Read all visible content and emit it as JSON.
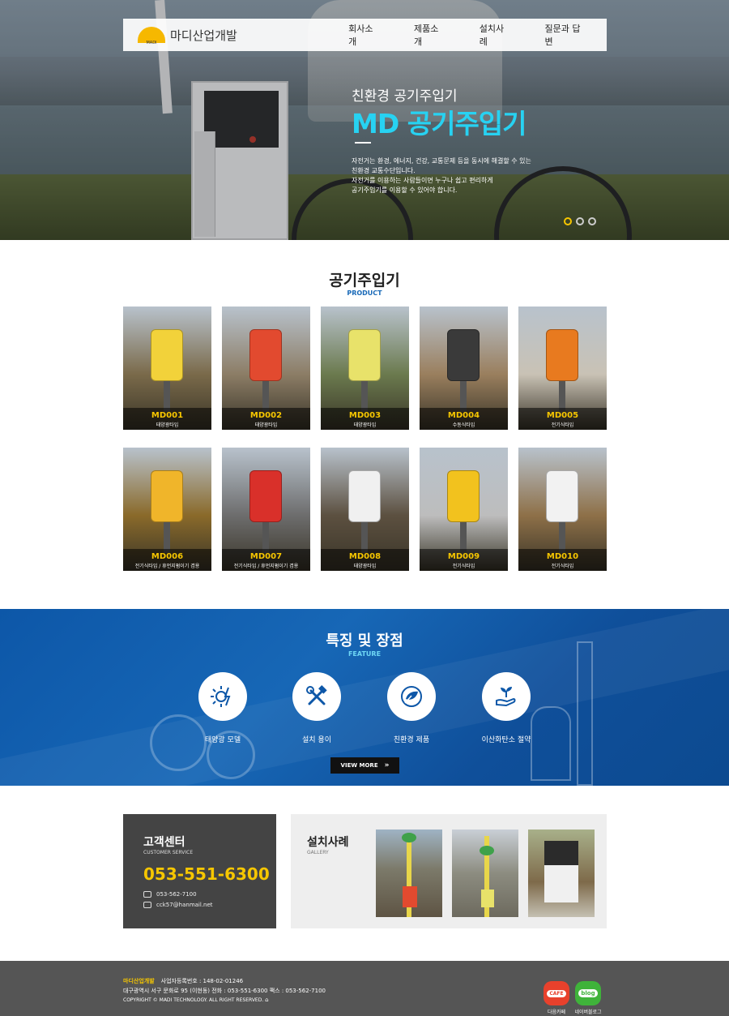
{
  "header": {
    "logo_text": "마디산업개발",
    "logo_badge": "MADI",
    "nav": [
      "회사소개",
      "제품소개",
      "설치사례",
      "질문과 답변"
    ]
  },
  "hero": {
    "subtitle": "친환경 공기주입기",
    "title": "MD 공기주입기",
    "desc": [
      "자전거는 환경, 에너지, 건강, 교통문제 등을 동시에 해결할 수 있는",
      "친환경 교통수단입니다.",
      "자전거를 이용하는 사람들이면 누구나 쉽고 편리하게",
      "공기주입기를 이용할 수 있어야 합니다."
    ],
    "slides": 3,
    "active_slide": 1
  },
  "products_section": {
    "title": "공기주입기",
    "subtitle": "PRODUCT",
    "items": [
      {
        "code": "MD001",
        "desc": "태양광타입",
        "bg": "#7a6a4a",
        "device": "#f2d23a"
      },
      {
        "code": "MD002",
        "desc": "태양광타입",
        "bg": "#8c7d66",
        "device": "#e24a2f"
      },
      {
        "code": "MD003",
        "desc": "태양광타입",
        "bg": "#6b7a4e",
        "device": "#e8e26a"
      },
      {
        "code": "MD004",
        "desc": "수동식타입",
        "bg": "#9a7f5e",
        "device": "#3a3a3a"
      },
      {
        "code": "MD005",
        "desc": "전기식타입",
        "bg": "#c9c2b5",
        "device": "#e87a1f"
      },
      {
        "code": "MD006",
        "desc": "전기식타입 / 휴먼지펌이기 겸용",
        "bg": "#8a6a2a",
        "device": "#f0b52a"
      },
      {
        "code": "MD007",
        "desc": "전기식타입 / 휴먼지펌이기 겸용",
        "bg": "#6d6d6d",
        "device": "#d9302a"
      },
      {
        "code": "MD008",
        "desc": "태양광타입",
        "bg": "#5c5040",
        "device": "#f0f0f0"
      },
      {
        "code": "MD009",
        "desc": "전기식타입",
        "bg": "#bdbdbd",
        "device": "#f2c21e"
      },
      {
        "code": "MD010",
        "desc": "전기식타입",
        "bg": "#8e7048",
        "device": "#f2f2f2"
      }
    ]
  },
  "feature_section": {
    "title": "특징 및 장점",
    "subtitle": "FEATURE",
    "items": [
      {
        "label": "태양광 모델",
        "icon": "solar-icon"
      },
      {
        "label": "설치 용이",
        "icon": "tools-icon"
      },
      {
        "label": "친환경 제품",
        "icon": "eco-globe-icon"
      },
      {
        "label": "이산화탄소 절약",
        "icon": "plant-hand-icon"
      }
    ],
    "button": "VIEW MORE"
  },
  "customer_center": {
    "title": "고객센터",
    "subtitle": "CUSTOMER SERVICE",
    "phone": "053-551-6300",
    "fax": "053-562-7100",
    "email": "cck57@hanmail.net"
  },
  "gallery": {
    "title": "설치사례",
    "subtitle": "GALLERY"
  },
  "footer": {
    "company": "마디산업개발",
    "biz_no": "사업자등록번호 : 148-02-01246",
    "address": "대구광역시 서구 문화로 95 (이현동)    전화 : 053-551-6300    팩스 : 053-562-7100",
    "copyright": "COPYRIGHT © MADI TECHNOLOGY. ALL RIGHT RESERVED.",
    "sns": [
      {
        "label": "다음카페",
        "badge": "CAFE",
        "color": "#e8412c"
      },
      {
        "label": "네이버블로그",
        "badge": "blog",
        "color": "#3fb33a"
      }
    ]
  }
}
